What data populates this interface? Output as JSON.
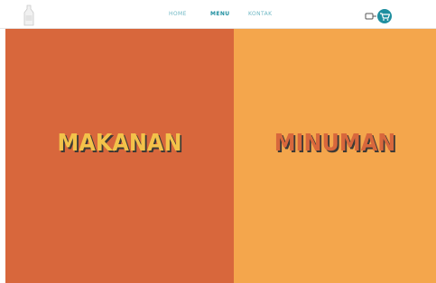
{
  "nav": {
    "home": "HOME",
    "menu": "MENU",
    "kontak": "KONTAK"
  },
  "panels": {
    "left_label": "MAKANAN",
    "right_label": "MINUMAN"
  },
  "colors": {
    "left_panel": "#d8673c",
    "right_panel": "#f4a64c",
    "accent": "#1f8fa0",
    "left_text": "#f3c24a",
    "right_text": "#d8673c",
    "text_shadow": "#3d3a36"
  },
  "icons": {
    "logo": "bottle-logo-icon",
    "cart": "shopping-cart-icon"
  }
}
